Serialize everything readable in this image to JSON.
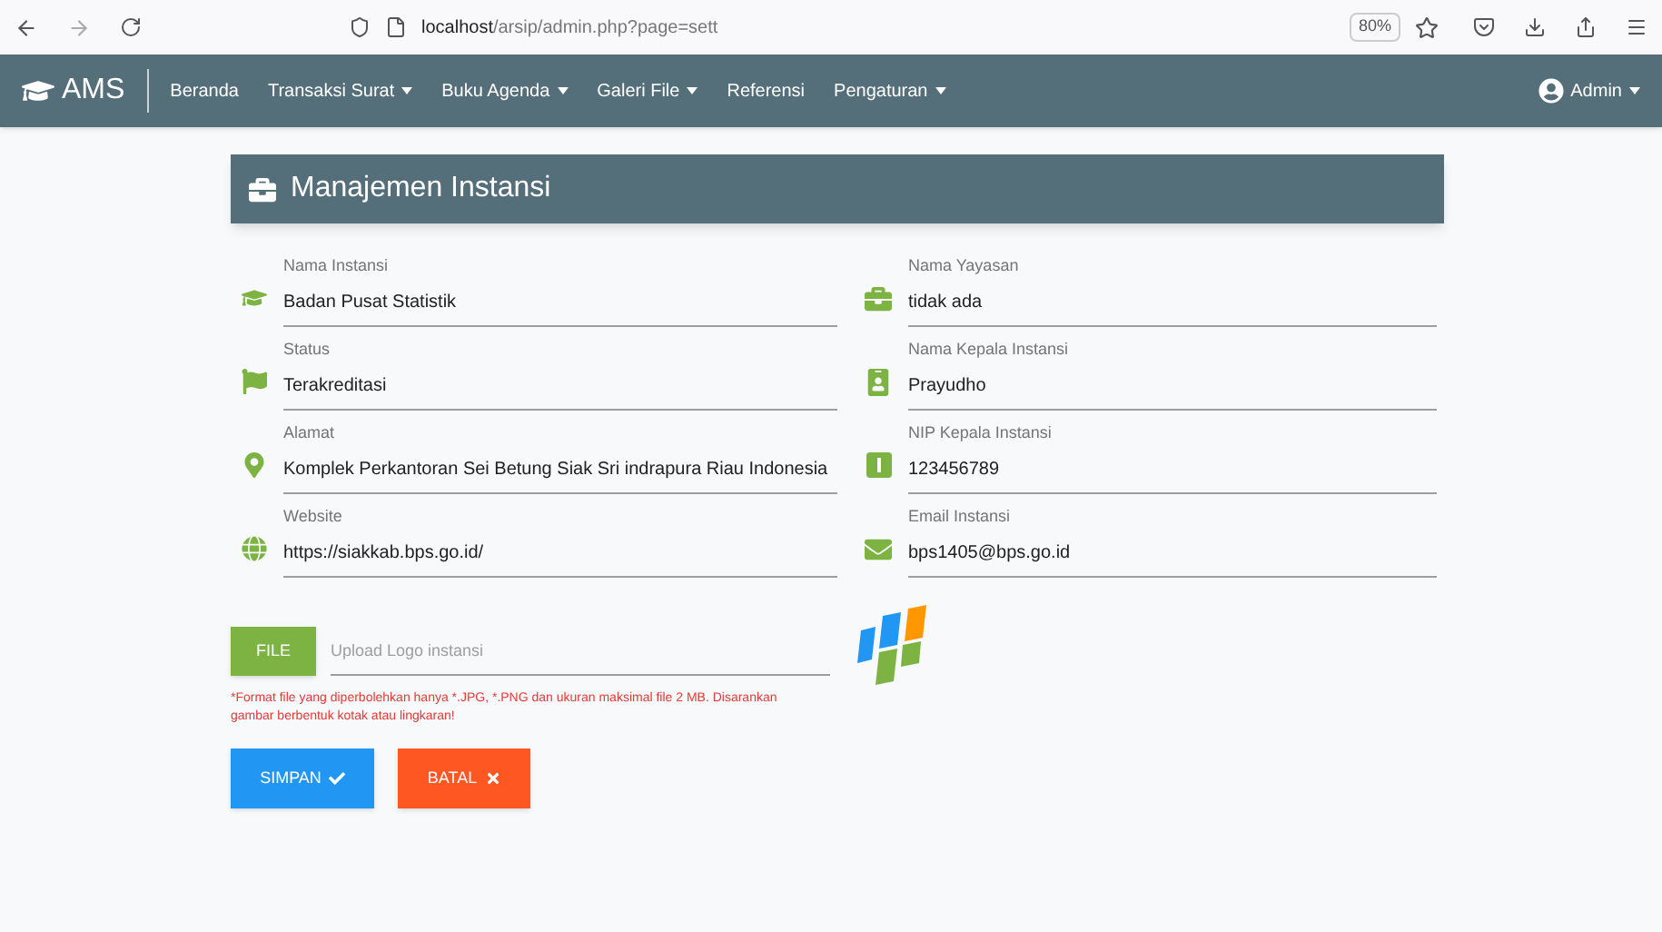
{
  "browser": {
    "url_host": "localhost",
    "url_path": "/arsip/admin.php?page=sett",
    "zoom": "80%"
  },
  "navbar": {
    "brand": "AMS",
    "items": [
      {
        "label": "Beranda",
        "dropdown": false
      },
      {
        "label": "Transaksi Surat",
        "dropdown": true
      },
      {
        "label": "Buku Agenda",
        "dropdown": true
      },
      {
        "label": "Galeri File",
        "dropdown": true
      },
      {
        "label": "Referensi",
        "dropdown": false
      },
      {
        "label": "Pengaturan",
        "dropdown": true
      }
    ],
    "user": "Admin"
  },
  "card": {
    "title": "Manajemen Instansi",
    "left_fields": [
      {
        "label": "Nama Instansi",
        "value": "Badan Pusat Statistik"
      },
      {
        "label": "Status",
        "value": "Terakreditasi"
      },
      {
        "label": "Alamat",
        "value": "Komplek Perkantoran Sei Betung Siak Sri indrapura Riau Indonesia"
      },
      {
        "label": "Website",
        "value": "https://siakkab.bps.go.id/"
      }
    ],
    "right_fields": [
      {
        "label": "Nama Yayasan",
        "value": "tidak ada"
      },
      {
        "label": "Nama Kepala Instansi",
        "value": "Prayudho"
      },
      {
        "label": "NIP Kepala Instansi",
        "value": "123456789"
      },
      {
        "label": "Email Instansi",
        "value": "bps1405@bps.go.id"
      }
    ],
    "file_button": "FILE",
    "file_placeholder": "Upload Logo instansi",
    "note": "*Format file yang diperbolehkan hanya *.JPG, *.PNG dan ukuran maksimal file 2 MB. Disarankan gambar berbentuk kotak atau lingkaran!",
    "save_button": "SIMPAN",
    "cancel_button": "BATAL"
  }
}
